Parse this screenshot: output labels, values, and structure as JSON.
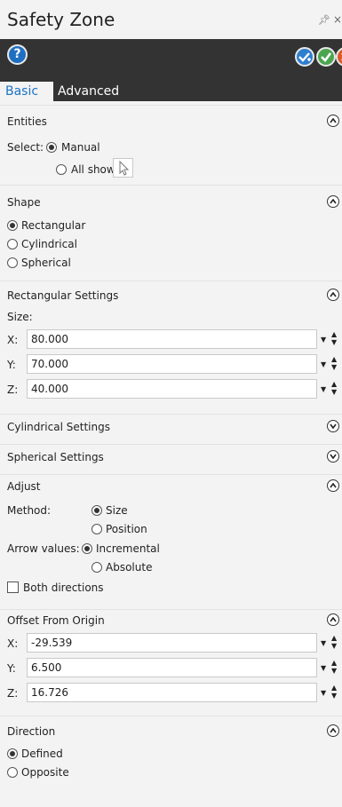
{
  "window": {
    "title": "Safety Zone",
    "pin_icon": "pin-icon",
    "close_glyph": "×"
  },
  "toolbar": {
    "help_label": "?",
    "apply_icon": "apply-icon",
    "ok_icon": "ok-icon",
    "cancel_icon": "cancel-icon"
  },
  "tabs": [
    {
      "label": "Basic",
      "active": true
    },
    {
      "label": "Advanced",
      "active": false
    }
  ],
  "entities": {
    "title": "Entities",
    "select_label": "Select:",
    "options": [
      {
        "label": "Manual",
        "selected": true
      },
      {
        "label": "All shown",
        "selected": false
      }
    ]
  },
  "shape": {
    "title": "Shape",
    "options": [
      {
        "label": "Rectangular",
        "selected": true
      },
      {
        "label": "Cylindrical",
        "selected": false
      },
      {
        "label": "Spherical",
        "selected": false
      }
    ]
  },
  "rectangular": {
    "title": "Rectangular Settings",
    "size_label": "Size:",
    "x_label": "X:",
    "x_value": "80.000",
    "y_label": "Y:",
    "y_value": "70.000",
    "z_label": "Z:",
    "z_value": "40.000"
  },
  "cylindrical": {
    "title": "Cylindrical Settings"
  },
  "spherical": {
    "title": "Spherical Settings"
  },
  "adjust": {
    "title": "Adjust",
    "method_label": "Method:",
    "method_options": [
      {
        "label": "Size",
        "selected": true
      },
      {
        "label": "Position",
        "selected": false
      }
    ],
    "arrow_label": "Arrow values:",
    "arrow_options": [
      {
        "label": "Incremental",
        "selected": true
      },
      {
        "label": "Absolute",
        "selected": false
      }
    ],
    "both_directions": {
      "label": "Both directions",
      "checked": false
    }
  },
  "offset": {
    "title": "Offset From Origin",
    "x_label": "X:",
    "x_value": "-29.539",
    "y_label": "Y:",
    "y_value": "6.500",
    "z_label": "Z:",
    "z_value": "16.726"
  },
  "direction": {
    "title": "Direction",
    "options": [
      {
        "label": "Defined",
        "selected": true
      },
      {
        "label": "Opposite",
        "selected": false
      }
    ]
  },
  "colors": {
    "accent": "#1a73c7",
    "toolbar": "#333333",
    "apply": "#2f7fcf",
    "ok": "#4ba54f",
    "cancel": "#d95b2a"
  }
}
